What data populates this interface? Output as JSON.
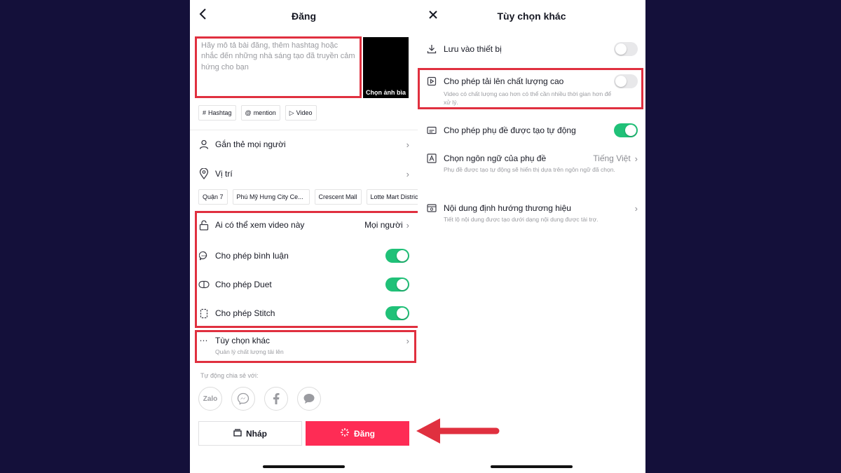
{
  "post_screen": {
    "title": "Đăng",
    "caption_placeholder": "Hãy mô tả bài đăng, thêm hashtag hoặc nhắc đến những nhà sáng tạo đã truyền cảm hứng cho bạn",
    "cover_label": "Chọn ảnh bìa",
    "chips": [
      {
        "icon": "#",
        "label": "Hashtag"
      },
      {
        "icon": "@",
        "label": "mention"
      },
      {
        "icon": "▷",
        "label": "Video"
      }
    ],
    "tag_people": "Gắn thẻ mọi người",
    "location": "Vị trí",
    "location_chips": [
      "Quận 7",
      "Phú Mỹ Hưng City Ce...",
      "Crescent Mall",
      "Lotte Mart Distric"
    ],
    "privacy": {
      "label": "Ai có thể xem video này",
      "value": "Mọi người"
    },
    "toggles": [
      {
        "label": "Cho phép bình luận",
        "on": true
      },
      {
        "label": "Cho phép Duet",
        "on": true
      },
      {
        "label": "Cho phép Stitch",
        "on": true
      }
    ],
    "more_options": {
      "label": "Tùy chọn khác",
      "sub": "Quản lý chất lượng tải lên"
    },
    "auto_share_label": "Tự động chia sẻ với:",
    "share_targets": [
      "Zalo",
      "Messenger",
      "Facebook",
      "Message"
    ],
    "draft_label": "Nháp",
    "post_label": "Đăng"
  },
  "options_screen": {
    "title": "Tùy chọn khác",
    "save_device": "Lưu vào thiết bị",
    "hq_upload": {
      "label": "Cho phép tải lên chất lượng cao",
      "sub": "Video có chất lượng cao hơn có thể cần nhiều thời gian hơn để xử lý."
    },
    "auto_captions": "Cho phép phụ đề được tạo tự động",
    "caption_lang": {
      "label": "Chọn ngôn ngữ của phụ đề",
      "value": "Tiếng Việt",
      "sub": "Phụ đề được tạo tự động sẽ hiển thị dựa trên ngôn ngữ đã chọn."
    },
    "branded": {
      "label": "Nội dung định hướng thương hiệu",
      "sub": "Tiết lộ nội dung được tạo dưới dạng nội dung được tài trợ."
    }
  },
  "colors": {
    "accent": "#fe2c55",
    "toggle_on": "#20c178",
    "highlight": "#e0303f",
    "background": "#14103a"
  }
}
